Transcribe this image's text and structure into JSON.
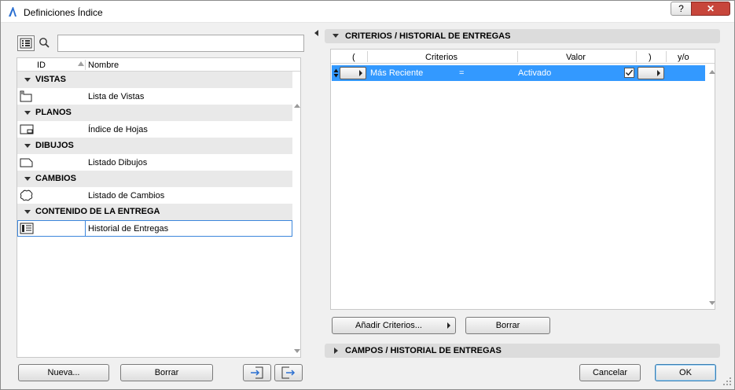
{
  "window": {
    "title": "Definiciones Índice",
    "help_label": "?",
    "close_label": "✕"
  },
  "left": {
    "search": {
      "value": "",
      "placeholder": ""
    },
    "columns": {
      "id": "ID",
      "name": "Nombre"
    },
    "groups": [
      {
        "label": "VISTAS",
        "item": {
          "name": "Lista de Vistas",
          "icon": "view-list-icon"
        }
      },
      {
        "label": "PLANOS",
        "item": {
          "name": "Índice de Hojas",
          "icon": "sheet-index-icon"
        }
      },
      {
        "label": "DIBUJOS",
        "item": {
          "name": "Listado Dibujos",
          "icon": "drawing-list-icon"
        }
      },
      {
        "label": "CAMBIOS",
        "item": {
          "name": "Listado de Cambios",
          "icon": "change-list-icon"
        }
      },
      {
        "label": "CONTENIDO DE LA ENTREGA",
        "item": {
          "name": "Historial de Entregas",
          "icon": "issue-history-icon"
        }
      }
    ],
    "buttons": {
      "new": "Nueva...",
      "delete": "Borrar"
    }
  },
  "right": {
    "criteria_section": "CRITERIOS /  HISTORIAL DE ENTREGAS",
    "criteria_columns": {
      "open_paren": "(",
      "criteria": "Criterios",
      "value": "Valor",
      "close_paren": ")",
      "andor": "y/o"
    },
    "criteria_row": {
      "criteria": "Más Reciente",
      "operator": "=",
      "value": "Activado",
      "checked": true
    },
    "add_criteria": "Añadir Criterios...",
    "delete": "Borrar",
    "fields_section": "CAMPOS /  HISTORIAL DE ENTREGAS"
  },
  "footer": {
    "cancel": "Cancelar",
    "ok": "OK"
  },
  "colors": {
    "selection": "#3399ff",
    "section_header": "#dcdcdc",
    "group_row": "#e9e9e9"
  }
}
